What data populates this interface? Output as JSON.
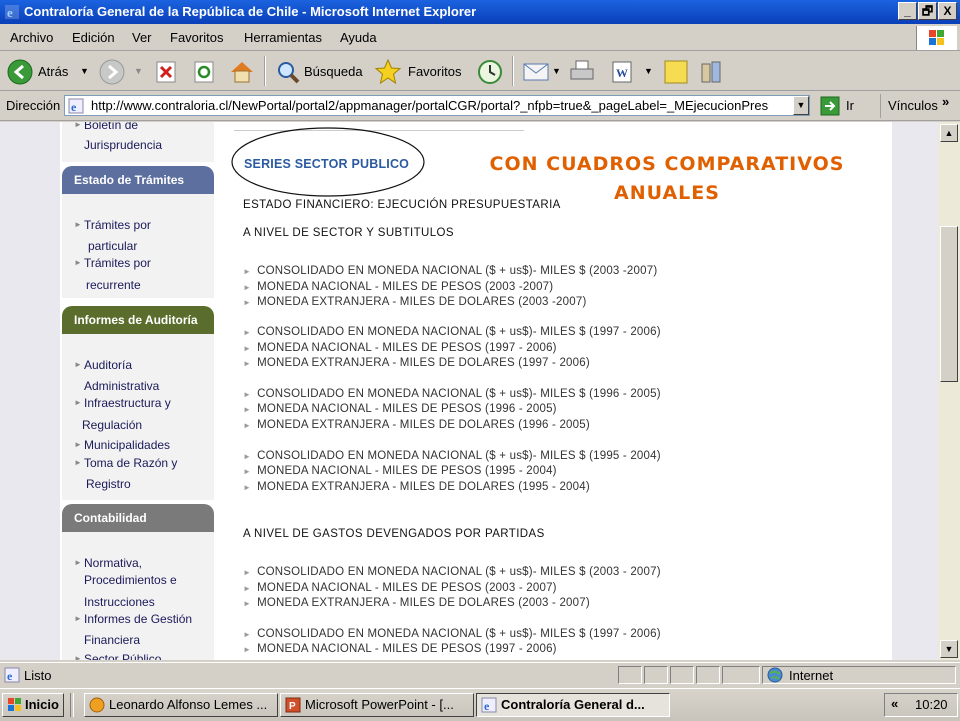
{
  "window": {
    "title": "Contraloría General de la República de Chile - Microsoft Internet Explorer",
    "min": "_",
    "max": "🗗",
    "close": "X"
  },
  "menu": [
    "Archivo",
    "Edición",
    "Ver",
    "Favoritos",
    "Herramientas",
    "Ayuda"
  ],
  "toolbar": {
    "back": "Atrás",
    "search": "Búsqueda",
    "favorites": "Favoritos"
  },
  "address": {
    "label": "Dirección",
    "url": "http://www.contraloria.cl/NewPortal/portal2/appmanager/portalCGR/portal?_nfpb=true&_pageLabel=_MEjecucionPresup",
    "go": "Ir",
    "links": "Vínculos"
  },
  "sidebar": {
    "top_links": [
      "Boletín de",
      "Jurisprudencia"
    ],
    "sections": [
      {
        "title": "Estado de Trámites",
        "color": "#5d6f9e",
        "links": [
          "Trámites por",
          "particular",
          "Trámites por",
          "recurrente"
        ]
      },
      {
        "title": "Informes de Auditoría",
        "color": "#5b6d2c",
        "links": [
          "Auditoría",
          "Administrativa",
          "Infraestructura y",
          "Regulación",
          "Municipalidades",
          "Toma de Razón y",
          "Registro"
        ]
      },
      {
        "title": "Contabilidad",
        "color": "#7a7a7a",
        "links": [
          "Normativa,",
          "Procedimientos e",
          "Instrucciones",
          "Informes de Gestión",
          "Financiera",
          "Sector Público"
        ]
      }
    ]
  },
  "main": {
    "series_title": "SERIES SECTOR PUBLICO",
    "annotation": [
      "CON CUADROS COMPARATIVOS",
      "ANUALES"
    ],
    "subtitle": "ESTADO FINANCIERO: EJECUCIÓN PRESUPUESTARIA",
    "section1": "A NIVEL DE SECTOR Y SUBTITULOS",
    "section2": "A NIVEL DE GASTOS DEVENGADOS POR PARTIDAS",
    "group1": [
      "CONSOLIDADO EN MONEDA NACIONAL ($ + us$)- MILES $ (2003 -2007)",
      "MONEDA NACIONAL - MILES DE PESOS (2003 -2007)",
      "MONEDA EXTRANJERA - MILES DE DOLARES (2003 -2007)"
    ],
    "group2": [
      "CONSOLIDADO EN MONEDA NACIONAL ($ + us$)- MILES $ (1997 - 2006)",
      "MONEDA NACIONAL - MILES DE PESOS (1997 - 2006)",
      "MONEDA EXTRANJERA - MILES DE DOLARES (1997 - 2006)"
    ],
    "group3": [
      "CONSOLIDADO EN MONEDA NACIONAL ($ + us$)- MILES $ (1996 - 2005)",
      "MONEDA NACIONAL - MILES DE PESOS (1996 - 2005)",
      "MONEDA EXTRANJERA - MILES DE DOLARES (1996 - 2005)"
    ],
    "group4": [
      "CONSOLIDADO EN MONEDA NACIONAL ($ + us$)- MILES $ (1995 - 2004)",
      "MONEDA NACIONAL - MILES DE PESOS (1995 - 2004)",
      "MONEDA EXTRANJERA - MILES DE DOLARES (1995 - 2004)"
    ],
    "group5": [
      "CONSOLIDADO EN MONEDA NACIONAL ($ + us$)- MILES $ (2003 - 2007)",
      "MONEDA NACIONAL - MILES DE PESOS (2003 - 2007)",
      "MONEDA EXTRANJERA - MILES DE DOLARES (2003 - 2007)"
    ],
    "group6": [
      "CONSOLIDADO EN MONEDA NACIONAL ($ + us$)- MILES $ (1997 - 2006)",
      "MONEDA NACIONAL - MILES DE PESOS (1997 - 2006)"
    ]
  },
  "status": {
    "text": "Listo",
    "zone": "Internet"
  },
  "taskbar": {
    "start": "Inicio",
    "tasks": [
      "Leonardo Alfonso Lemes ...",
      "Microsoft PowerPoint - [...",
      "Contraloría General d..."
    ],
    "clock": "10:20"
  },
  "colors": {
    "annotation": "#e06000",
    "link_blue": "#2a5aa0"
  }
}
